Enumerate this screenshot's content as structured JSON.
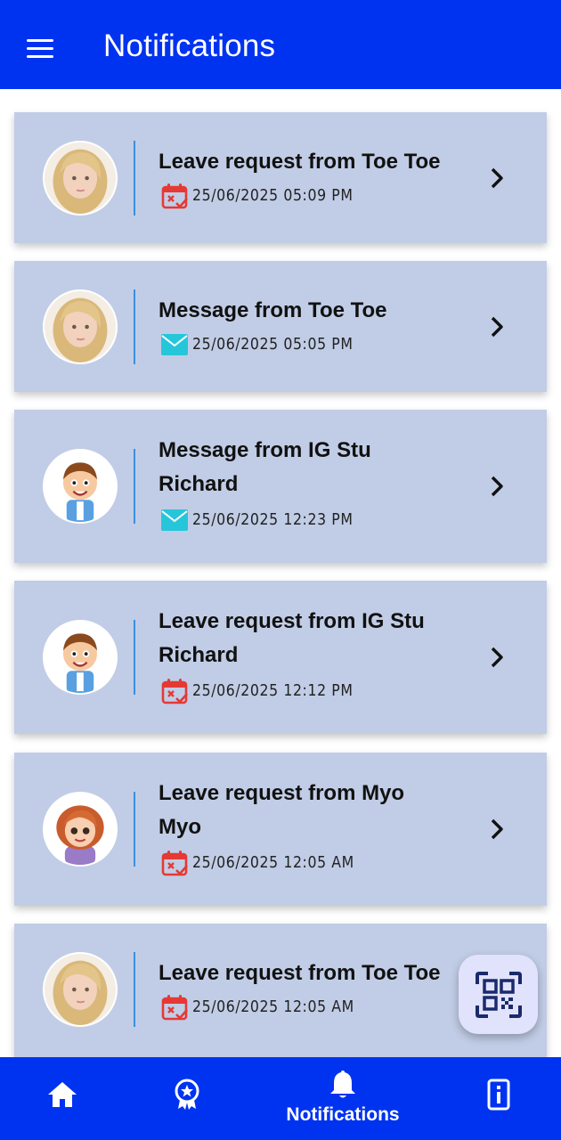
{
  "app_bar": {
    "title": "Notifications"
  },
  "notifications": [
    {
      "title": "Leave request from Toe Toe",
      "type": "leave",
      "icon": "calendar-x-icon",
      "datetime": "25/06/2025 05:09 PM",
      "avatar": "girl-blonde-avatar"
    },
    {
      "title": "Message from Toe Toe",
      "type": "message",
      "icon": "envelope-icon",
      "datetime": "25/06/2025 05:05 PM",
      "avatar": "girl-blonde-avatar"
    },
    {
      "title": "Message from IG Stu Richard",
      "type": "message",
      "icon": "envelope-icon",
      "datetime": "25/06/2025 12:23 PM",
      "avatar": "cartoon-boy-avatar"
    },
    {
      "title": "Leave request from IG Stu Richard",
      "type": "leave",
      "icon": "calendar-x-icon",
      "datetime": "25/06/2025 12:12 PM",
      "avatar": "cartoon-boy-avatar"
    },
    {
      "title": "Leave request from Myo Myo",
      "type": "leave",
      "icon": "calendar-x-icon",
      "datetime": "25/06/2025 12:05 AM",
      "avatar": "cartoon-girl-avatar"
    },
    {
      "title": "Leave request from Toe Toe",
      "type": "leave",
      "icon": "calendar-x-icon",
      "datetime": "25/06/2025 12:05 AM",
      "avatar": "girl-blonde-avatar"
    }
  ],
  "fab": {
    "icon": "qr-code-scan-icon"
  },
  "bottom_nav": {
    "items": [
      {
        "icon": "home-icon",
        "label": ""
      },
      {
        "icon": "award-badge-icon",
        "label": ""
      },
      {
        "icon": "bell-icon",
        "label": "Notifications",
        "active": true
      },
      {
        "icon": "id-card-icon",
        "label": ""
      }
    ]
  },
  "colors": {
    "primary": "#0033f0",
    "card_background": "#c1cde6",
    "divider": "#3a8fe0",
    "leave_icon": "#e53935",
    "message_icon": "#26c6da",
    "fab_background": "#e1e2fb",
    "fab_icon": "#1a2a6c"
  }
}
